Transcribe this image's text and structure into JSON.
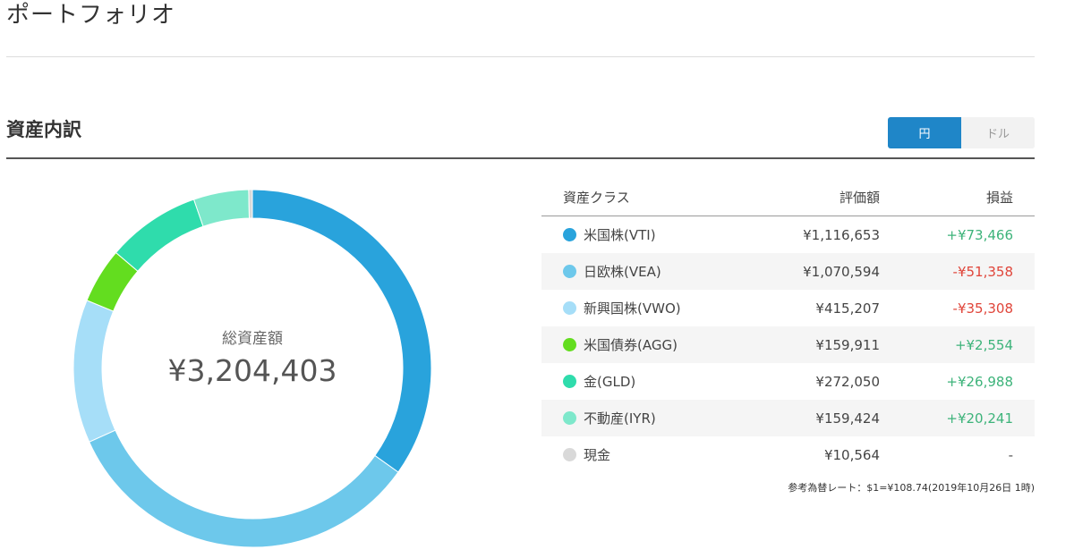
{
  "page": {
    "title": "ポートフォリオ"
  },
  "section": {
    "title": "資産内訳"
  },
  "currency_toggle": {
    "options": [
      "円",
      "ドル"
    ],
    "selected": "円"
  },
  "total": {
    "label": "総資産額",
    "value": "¥3,204,403"
  },
  "table": {
    "headers": {
      "asset_class": "資産クラス",
      "valuation": "評価額",
      "profit_loss": "損益"
    },
    "rows": [
      {
        "name": "米国株(VTI)",
        "value": "¥1,116,653",
        "amount": 1116653,
        "pl": "+¥73,466",
        "pl_sign": "pos",
        "color": "#29a3dc"
      },
      {
        "name": "日欧株(VEA)",
        "value": "¥1,070,594",
        "amount": 1070594,
        "pl": "-¥51,358",
        "pl_sign": "neg",
        "color": "#6dc8eb"
      },
      {
        "name": "新興国株(VWO)",
        "value": "¥415,207",
        "amount": 415207,
        "pl": "-¥35,308",
        "pl_sign": "neg",
        "color": "#a6def8"
      },
      {
        "name": "米国債券(AGG)",
        "value": "¥159,911",
        "amount": 159911,
        "pl": "+¥2,554",
        "pl_sign": "pos",
        "color": "#63dd1f"
      },
      {
        "name": "金(GLD)",
        "value": "¥272,050",
        "amount": 272050,
        "pl": "+¥26,988",
        "pl_sign": "pos",
        "color": "#2fdcac"
      },
      {
        "name": "不動産(IYR)",
        "value": "¥159,424",
        "amount": 159424,
        "pl": "+¥20,241",
        "pl_sign": "pos",
        "color": "#7ee8cb"
      },
      {
        "name": "現金",
        "value": "¥10,564",
        "amount": 10564,
        "pl": "-",
        "pl_sign": "none",
        "color": "#d9d9d9"
      }
    ]
  },
  "rate_note": "参考為替レート：$1=¥108.74(2019年10月26日 1時)"
}
